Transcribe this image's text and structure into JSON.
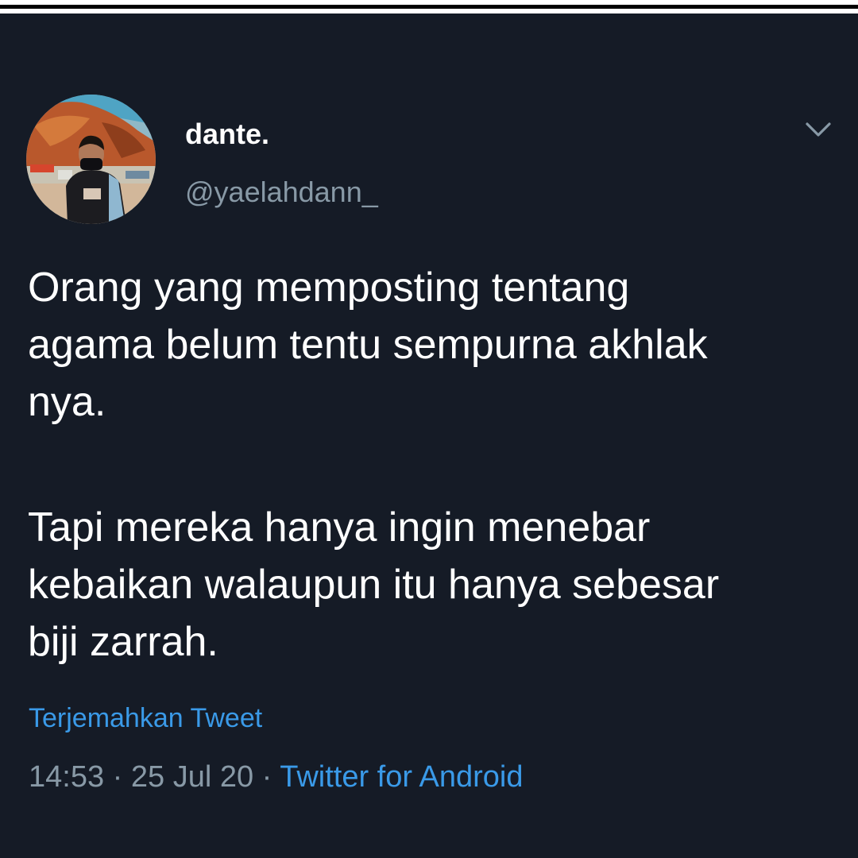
{
  "tweet": {
    "display_name": "dante.",
    "handle": "@yaelahdann_",
    "paragraphs": [
      [
        "Orang yang memposting tentang",
        "agama belum tentu sempurna akhlak",
        "nya."
      ],
      [
        "Tapi mereka hanya ingin menebar",
        "kebaikan walaupun itu hanya sebesar",
        "biji zarrah."
      ]
    ],
    "translate_label": "Terjemahkan Tweet",
    "time": "14:53",
    "separator": "·",
    "date": "25 Jul 20",
    "source": "Twitter for Android"
  },
  "icons": {
    "menu": "chevron-down-icon"
  },
  "colors": {
    "background": "#151b26",
    "text_primary": "#ffffff",
    "text_secondary": "#8899a6",
    "link": "#3a9ae8"
  }
}
